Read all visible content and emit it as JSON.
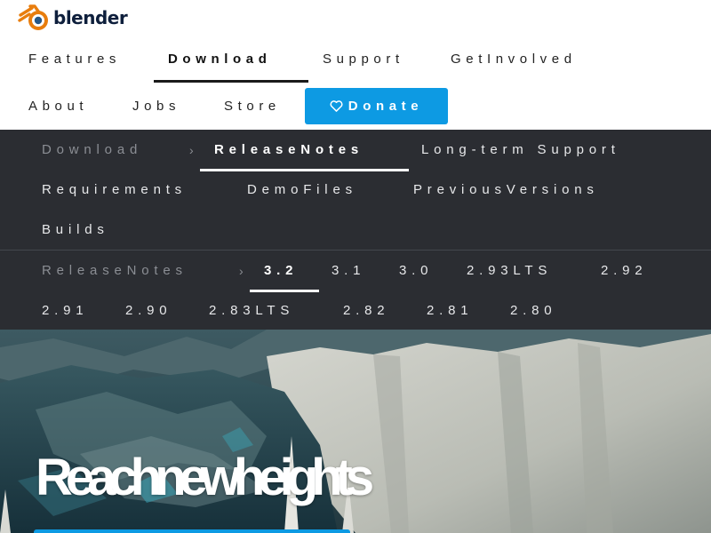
{
  "brand": {
    "name": "blender",
    "accent": "#0d9ae3",
    "logo_orange": "#e87d0d",
    "logo_blue": "#265787",
    "logo_text_color": "#0e1f3c"
  },
  "main_nav": {
    "items": [
      {
        "label": "Features",
        "active": false
      },
      {
        "label": "Download",
        "active": true
      },
      {
        "label": "Support",
        "active": false
      },
      {
        "label": "GetInvolved",
        "active": false
      },
      {
        "label": "About",
        "active": false
      },
      {
        "label": "Jobs",
        "active": false
      },
      {
        "label": "Store",
        "active": false
      }
    ],
    "donate_label": "Donate",
    "donate_icon": "heart-icon"
  },
  "download_nav": {
    "breadcrumb": "Download",
    "separator": "›",
    "items": [
      {
        "label": "ReleaseNotes",
        "active": true
      },
      {
        "label": "Long-term Support",
        "active": false
      },
      {
        "label": "Requirements",
        "active": false
      },
      {
        "label": "DemoFiles",
        "active": false
      },
      {
        "label": "PreviousVersions",
        "active": false
      },
      {
        "label": "Builds",
        "active": false
      }
    ]
  },
  "release_nav": {
    "breadcrumb": "ReleaseNotes",
    "separator": "›",
    "versions": [
      {
        "label": "3.2",
        "active": true
      },
      {
        "label": "3.1",
        "active": false
      },
      {
        "label": "3.0",
        "active": false
      },
      {
        "label": "2.93LTS",
        "active": false
      },
      {
        "label": "2.92",
        "active": false
      },
      {
        "label": "2.91",
        "active": false
      },
      {
        "label": "2.90",
        "active": false
      },
      {
        "label": "2.83LTS",
        "active": false
      },
      {
        "label": "2.82",
        "active": false
      },
      {
        "label": "2.81",
        "active": false
      },
      {
        "label": "2.80",
        "active": false
      }
    ]
  },
  "hero": {
    "title": "Reachnewheights",
    "colors": {
      "sky": "#2f4a52",
      "ice": "#c9cbc4",
      "water": "#1f3f4a"
    }
  }
}
